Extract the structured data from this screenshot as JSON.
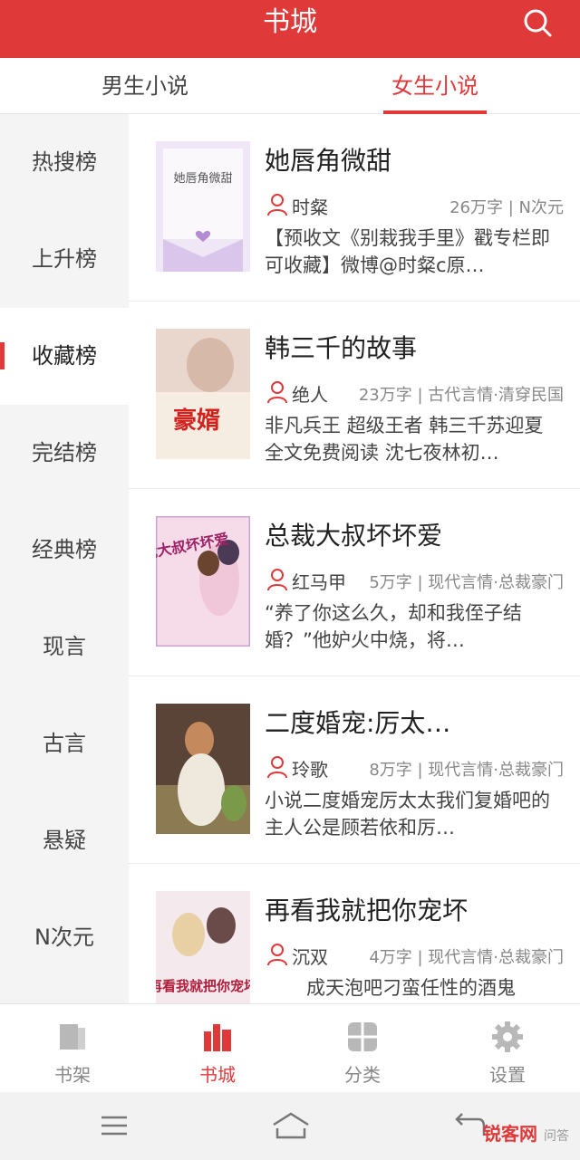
{
  "header": {
    "title": "书城",
    "search_icon": "search-icon"
  },
  "tabs": [
    {
      "label": "男生小说",
      "active": false
    },
    {
      "label": "女生小说",
      "active": true
    }
  ],
  "sidebar": {
    "items": [
      {
        "label": "热搜榜",
        "active": false
      },
      {
        "label": "上升榜",
        "active": false
      },
      {
        "label": "收藏榜",
        "active": true
      },
      {
        "label": "完结榜",
        "active": false
      },
      {
        "label": "经典榜",
        "active": false
      },
      {
        "label": "现言",
        "active": false
      },
      {
        "label": "古言",
        "active": false
      },
      {
        "label": "悬疑",
        "active": false
      },
      {
        "label": "N次元",
        "active": false
      }
    ]
  },
  "books": [
    {
      "title": "她唇角微甜",
      "author": "时粲",
      "info": "26万字 | N次元",
      "desc": "【预收文《别栽我手里》戳专栏即可收藏】微博@时粲c原…",
      "cover_text": "她唇角微甜"
    },
    {
      "title": "韩三千的故事",
      "author": "绝人",
      "info": "23万字 | 古代言情·清穿民国",
      "desc": "非凡兵王 超级王者 韩三千苏迎夏全文免费阅读 沈七夜林初…",
      "cover_text": "豪婿"
    },
    {
      "title": "总裁大叔坏坏爱",
      "author": "红马甲",
      "info": "5万字 | 现代言情·总裁豪门",
      "desc": "“养了你这么久，却和我侄子结婚？”他妒火中烧，将…",
      "cover_text": "总裁大叔坏坏爱"
    },
    {
      "title": "二度婚宠:厉太…",
      "author": "玲歌",
      "info": "8万字 | 现代言情·总裁豪门",
      "desc": "小说二度婚宠厉太太我们复婚吧的主人公是顾若依和厉…",
      "cover_text": ""
    },
    {
      "title": "再看我就把你宠坏",
      "author": "沉双",
      "info": "4万字 | 现代言情·总裁豪门",
      "desc": "成天泡吧刁蛮任性的酒鬼",
      "cover_text": "再看我就把你宠坏"
    }
  ],
  "bottom_nav": [
    {
      "label": "书架",
      "icon": "bookshelf-icon",
      "active": false
    },
    {
      "label": "书城",
      "icon": "bookstore-icon",
      "active": true
    },
    {
      "label": "分类",
      "icon": "category-icon",
      "active": false
    },
    {
      "label": "设置",
      "icon": "settings-gear-icon",
      "active": false
    }
  ],
  "watermark": {
    "brand": "锐客网",
    "sub": "问答"
  },
  "colors": {
    "accent": "#e0393a",
    "sidebar_bg": "#f4f4f4",
    "text": "#222222",
    "muted": "#888888"
  }
}
